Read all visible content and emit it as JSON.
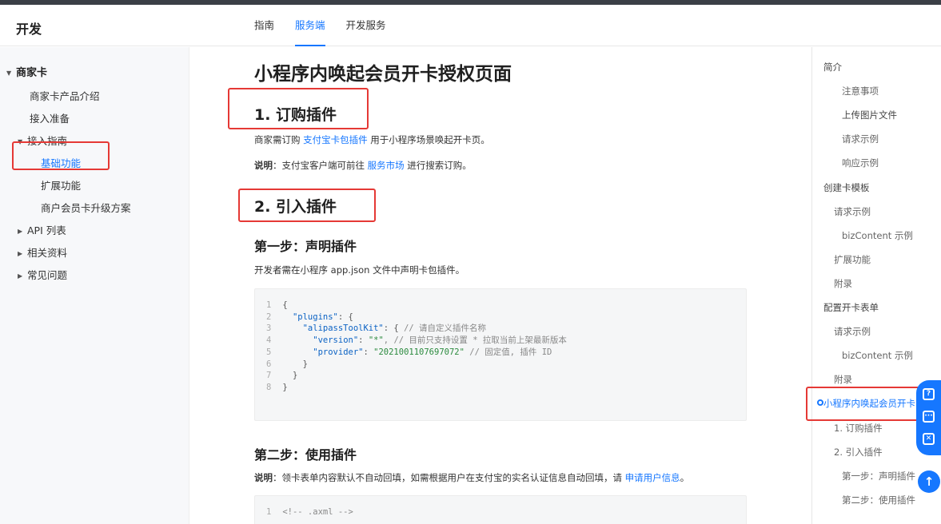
{
  "header": {
    "brand": "开发",
    "tabs": [
      "指南",
      "服务端",
      "开发服务"
    ]
  },
  "sidebar": {
    "section": "商家卡",
    "items": [
      "商家卡产品介绍",
      "接入准备",
      "接入指南",
      "基础功能",
      "扩展功能",
      "商户会员卡升级方案",
      "API 列表",
      "相关资料",
      "常见问题"
    ]
  },
  "main": {
    "title": "小程序内唤起会员开卡授权页面",
    "s1": {
      "heading": "1. 订购插件",
      "p1_pre": "商家需订购 ",
      "p1_link": "支付宝卡包插件",
      "p1_post": " 用于小程序场景唤起开卡页。",
      "p2_label": "说明",
      "p2_pre": "：支付宝客户端可前往 ",
      "p2_link": "服务市场",
      "p2_post": " 进行搜索订购。"
    },
    "s2": {
      "heading": "2. 引入插件",
      "step1": "第一步：声明插件",
      "step1_desc": "开发者需在小程序 app.json 文件中声明卡包插件。",
      "step2": "第二步：使用插件",
      "step2_label": "说明",
      "step2_pre": "：领卡表单内容默认不自动回填，如需根据用户在支付宝的实名认证信息自动回填，请 ",
      "step2_link": "申请用户信息",
      "step2_post": "。"
    },
    "code1": [
      {
        "n": "1",
        "ind": "",
        "key": "",
        "mid": "{",
        "str": "",
        "cm": ""
      },
      {
        "n": "2",
        "ind": "  ",
        "key": "\"plugins\"",
        "mid": ": {",
        "str": "",
        "cm": ""
      },
      {
        "n": "3",
        "ind": "    ",
        "key": "\"alipassToolKit\"",
        "mid": ": { ",
        "str": "",
        "cm": "// 请自定义插件名称"
      },
      {
        "n": "4",
        "ind": "      ",
        "key": "\"version\"",
        "mid": ": ",
        "str": "\"*\"",
        "cm": ", // 目前只支持设置 * 拉取当前上架最新版本"
      },
      {
        "n": "5",
        "ind": "      ",
        "key": "\"provider\"",
        "mid": ": ",
        "str": "\"2021001107697072\"",
        "cm": " // 固定值, 插件 ID"
      },
      {
        "n": "6",
        "ind": "    ",
        "key": "",
        "mid": "}",
        "str": "",
        "cm": ""
      },
      {
        "n": "7",
        "ind": "  ",
        "key": "",
        "mid": "}",
        "str": "",
        "cm": ""
      },
      {
        "n": "8",
        "ind": "",
        "key": "",
        "mid": "}",
        "str": "",
        "cm": ""
      }
    ],
    "code2": [
      {
        "n": "1",
        "ind": "",
        "key": "",
        "mid": "",
        "str": "",
        "cm": "<!-- .axml -->"
      }
    ]
  },
  "toc": {
    "items": [
      "简介",
      "注意事项",
      "上传图片文件",
      "请求示例",
      "响应示例",
      "创建卡模板",
      "请求示例",
      "bizContent 示例",
      "扩展功能",
      "附录",
      "配置开卡表单",
      "请求示例",
      "bizContent 示例",
      "附录",
      "小程序内唤起会员开卡",
      "1. 订购插件",
      "2. 引入插件",
      "第一步：声明插件",
      "第二步：使用插件"
    ]
  },
  "float": {
    "help": "?",
    "chat": "···",
    "mail": "✕",
    "top": "↑"
  },
  "colors": {
    "accent": "#1677ff",
    "highlight_box": "#e53935"
  }
}
